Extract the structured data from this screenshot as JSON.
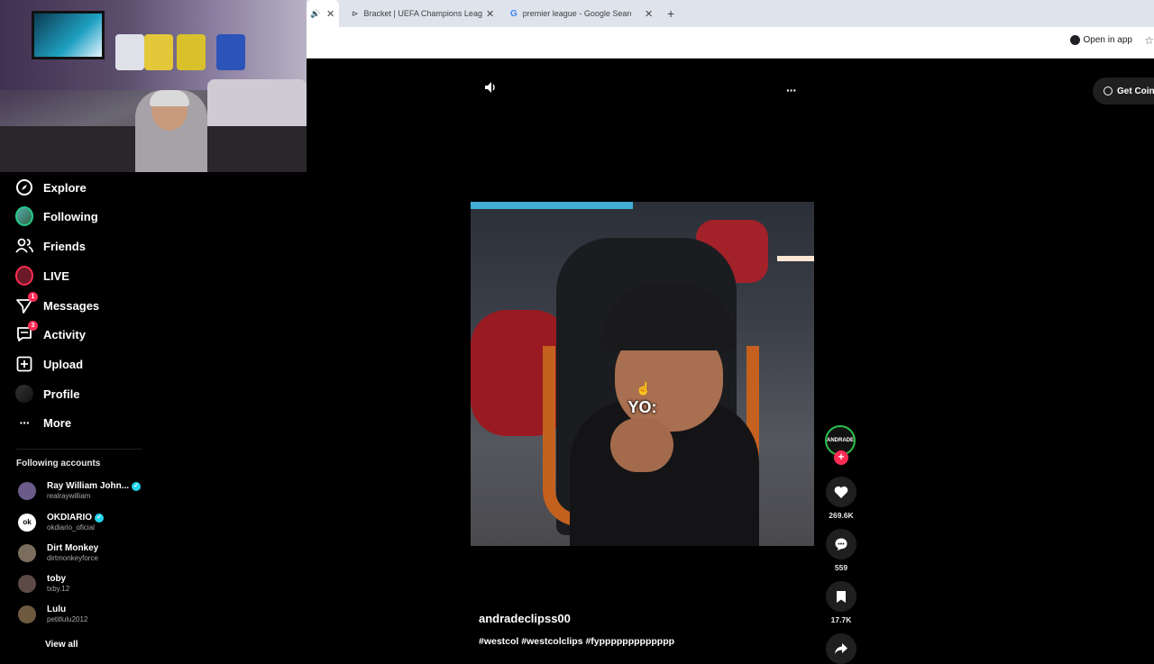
{
  "browser": {
    "tabs": [
      {
        "label": ""
      },
      {
        "label": "Bracket | UEFA Champions Leag"
      },
      {
        "label": "premier league - Google Search"
      }
    ],
    "new_tab": "+",
    "open_in_app": "Open in app"
  },
  "sidebar": {
    "items": [
      {
        "label": "Explore",
        "icon": "compass-icon"
      },
      {
        "label": "Following",
        "icon": "following-avatar-icon"
      },
      {
        "label": "Friends",
        "icon": "friends-icon"
      },
      {
        "label": "LIVE",
        "icon": "live-icon"
      },
      {
        "label": "Messages",
        "icon": "messages-icon",
        "badge": "1"
      },
      {
        "label": "Activity",
        "icon": "activity-icon",
        "badge": "3"
      },
      {
        "label": "Upload",
        "icon": "upload-icon"
      },
      {
        "label": "Profile",
        "icon": "profile-avatar-icon"
      },
      {
        "label": "More",
        "icon": "more-icon"
      }
    ],
    "following_title": "Following accounts",
    "accounts": [
      {
        "name": "Ray William John...",
        "handle": "realraywilliam",
        "verified": true,
        "color": "#6b5b8a"
      },
      {
        "name": "OKDIARIO",
        "handle": "okdiario_oficial",
        "verified": true,
        "color": "#ffffff"
      },
      {
        "name": "Dirt Monkey",
        "handle": "dirtmonkeyforce",
        "verified": false,
        "color": "#7a6d5d"
      },
      {
        "name": "toby",
        "handle": "txby.12",
        "verified": false,
        "color": "#5c4a47"
      },
      {
        "name": "Lulu",
        "handle": "petitlulu2012",
        "verified": false,
        "color": "#6e5a3e"
      }
    ],
    "view_all": "View all"
  },
  "main": {
    "get_coins": "Get Coin",
    "video_caption": "YO:",
    "creator_label": "ANDRADE",
    "likes": "269.6K",
    "comments": "559",
    "saves": "17.7K",
    "username": "andradeclipss00",
    "hashtags": "#westcol #westcolclips #fyppppppppppppp"
  },
  "colors": {
    "accent": "#fe2c55",
    "verified": "#20d5ec"
  }
}
